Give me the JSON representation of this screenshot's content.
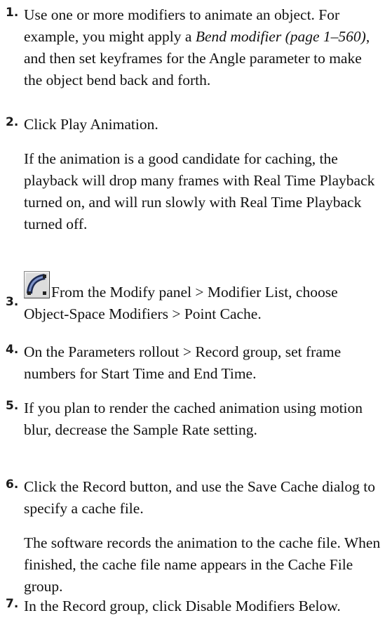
{
  "steps": [
    {
      "number": "1.",
      "text_before": "Use one or more modifiers to animate an object. For example, you might apply a ",
      "link_text": "Bend modifier (page 1–560)",
      "text_after": ", and then set keyframes for the Angle parameter to make the object bend back and forth."
    },
    {
      "number": "2.",
      "text": "Click Play Animation.",
      "note": "If the animation is a good candidate for caching, the playback will drop many frames with Real Time Playback turned on, and will run slowly with Real Time Playback turned off."
    },
    {
      "number": "3.",
      "icon": "bend-modifier-icon",
      "text": "From the Modify panel > Modifier List, choose Object-Space Modifiers > Point Cache."
    },
    {
      "number": "4.",
      "text": "On the Parameters rollout > Record group, set frame numbers for Start Time and End Time."
    },
    {
      "number": "5.",
      "text": "If you plan to render the cached animation using motion blur, decrease the Sample Rate setting."
    },
    {
      "number": "6.",
      "text": "Click the Record button, and use the Save Cache dialog to specify a cache file.",
      "note": "The software records the animation to the cache file. When finished, the cache file name appears in the Cache File group."
    },
    {
      "number": "7.",
      "text": "In the Record group, click Disable Modifiers Below."
    }
  ]
}
